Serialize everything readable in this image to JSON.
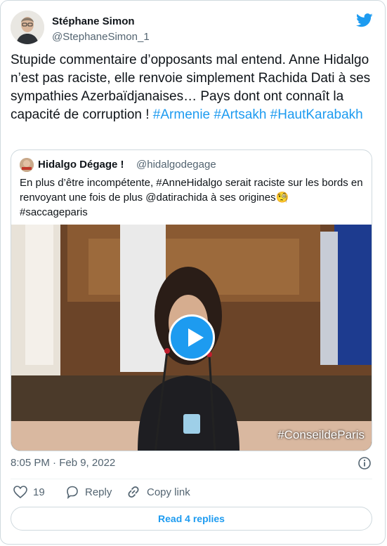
{
  "author": {
    "name": "Stéphane Simon",
    "handle": "@StephaneSimon_1"
  },
  "tweet": {
    "text_plain": "Stupide commentaire d’opposants mal entend. Anne Hidalgo n’est pas raciste, elle renvoie simplement Rachida Dati à ses sympathies Azerbaïdjanaises… Pays dont ont connaît la capacité de corruption ! ",
    "hashtags": [
      "#Armenie",
      "#Artsakh",
      "#HautKarabakh"
    ]
  },
  "quoted": {
    "name": "Hidalgo Dégage !",
    "handle": "@hidalgodegage",
    "text": "En plus d’être incompétente, #AnneHidalgo serait raciste sur les bords en renvoyant une fois de plus @datirachida à ses origines🧐",
    "text_line2": "#saccageparis",
    "media_watermark": "#ConseildeParis"
  },
  "meta": {
    "timestamp": "8:05 PM · Feb 9, 2022"
  },
  "actions": {
    "like_count": "19",
    "reply_label": "Reply",
    "copy_link_label": "Copy link",
    "read_replies_label": "Read 4 replies"
  },
  "colors": {
    "accent": "#1d9bf0",
    "text_primary": "#0f1419",
    "text_secondary": "#536471",
    "border": "#cfd9de"
  },
  "icons": [
    "twitter-bird-icon",
    "play-icon",
    "info-icon",
    "heart-icon",
    "reply-icon",
    "link-icon"
  ]
}
